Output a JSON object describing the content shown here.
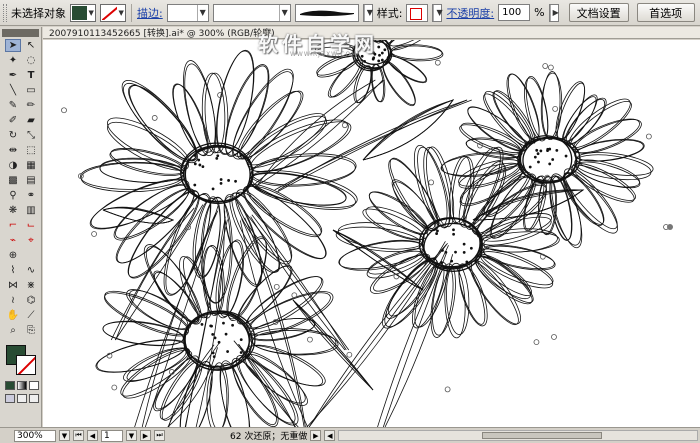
{
  "control_bar": {
    "selection_label": "未选择对象",
    "fill_color": "#284c33",
    "stroke_label": "描边:",
    "style_label": "样式:",
    "opacity_label": "不透明度:",
    "opacity_value": "100",
    "opacity_unit": "%",
    "doc_settings_label": "文档设置",
    "preferences_label": "首选项"
  },
  "document": {
    "tab_title": "20079101134526​65 [转换].ai* @ 300% (RGB/轮廓)"
  },
  "watermark": {
    "text": "软件自学网",
    "sub": "WWW.RJZXW.COM"
  },
  "status_bar": {
    "zoom": "300%",
    "page": "1",
    "status_text": "62 次还原；无重做"
  },
  "icons": {
    "selection": "selection-arrow-icon",
    "direct_selection": "direct-selection-icon",
    "pen": "pen-icon",
    "type": "type-icon",
    "zoom": "zoom-icon",
    "hand": "hand-icon"
  }
}
